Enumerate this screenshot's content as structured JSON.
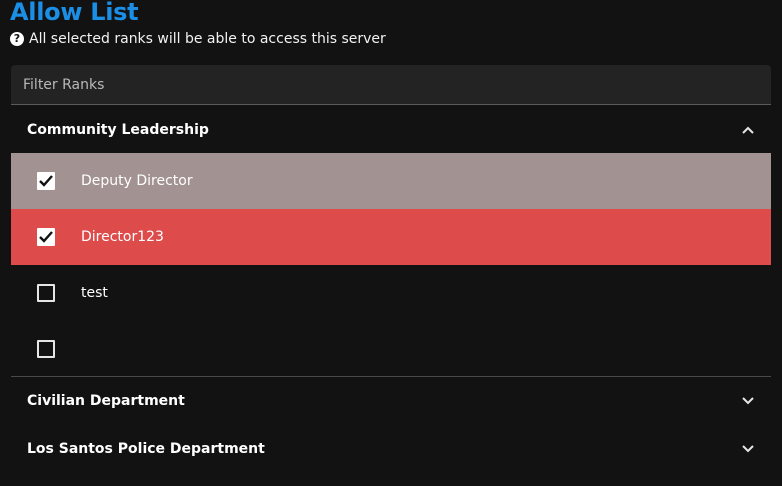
{
  "page": {
    "title": "Allow List",
    "subtitle": "All selected ranks will be able to access this server",
    "help_icon": "question-circle-icon"
  },
  "filter": {
    "placeholder": "Filter Ranks",
    "value": ""
  },
  "groups": [
    {
      "name": "Community Leadership",
      "expanded": true,
      "chevron_icon": "chevron-up-icon",
      "ranks": [
        {
          "label": "Deputy Director",
          "checked": true,
          "state": "hovered",
          "bg": "#a39292"
        },
        {
          "label": "Director123",
          "checked": true,
          "state": "selected",
          "bg": "#dd4b4b"
        },
        {
          "label": "test",
          "checked": false,
          "state": "normal",
          "bg": "transparent"
        },
        {
          "label": "",
          "checked": false,
          "state": "normal",
          "bg": "transparent"
        }
      ]
    },
    {
      "name": "Civilian Department",
      "expanded": false,
      "chevron_icon": "chevron-down-icon"
    },
    {
      "name": "Los Santos Police Department",
      "expanded": false,
      "chevron_icon": "chevron-down-icon"
    }
  ],
  "colors": {
    "background": "#121212",
    "title": "#1b8ee6",
    "filter_bg": "#232323",
    "hover_row": "#a39292",
    "selected_row": "#dd4b4b"
  }
}
